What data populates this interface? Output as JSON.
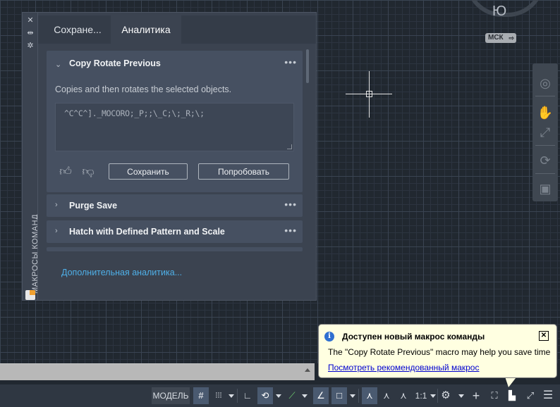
{
  "viewcube": {
    "face_label": "Ю",
    "ucs_label": "МСК"
  },
  "palette": {
    "side_title": "МАКРОСЫ КОМАНД",
    "tabs": [
      {
        "label": "Сохране..."
      },
      {
        "label": "Аналитика"
      }
    ],
    "active_tab": "Аналитика",
    "expanded_macro": {
      "title": "Copy Rotate Previous",
      "description": "Copies and then rotates the selected objects.",
      "code": "^C^C^]._MOCORO;_P;;\\_C;\\;_R;\\;",
      "save_label": "Сохранить",
      "try_label": "Попробовать"
    },
    "macros": [
      {
        "title": "Purge Save"
      },
      {
        "title": "Hatch with Defined Pattern and Scale"
      }
    ],
    "more_link": "Дополнительная аналитика..."
  },
  "statusbar": {
    "model_label": "МОДЕЛЬ",
    "scale_label": "1:1"
  },
  "notification": {
    "title": "Доступен новый макрос команды",
    "message": "The \"Copy Rotate Previous\" macro may help you save time",
    "link": "Посмотреть рекомендованный макрос"
  },
  "icons": {
    "close": "close-icon",
    "autohide": "autohide-icon",
    "properties": "gear-icon",
    "thumbs_up": "thumbs-up-icon",
    "thumbs_down": "thumbs-down-icon"
  },
  "colors": {
    "canvas": "#212830",
    "palette_bg": "#3b4350",
    "card_bg": "#465061",
    "link": "#4fb0e8",
    "notification_bg": "#ffffe1",
    "statusbar": "#2f3742"
  }
}
